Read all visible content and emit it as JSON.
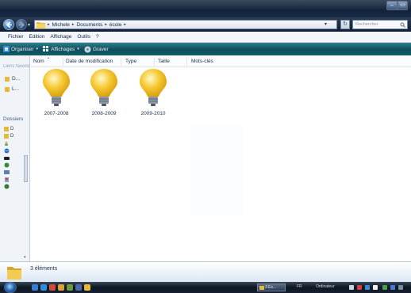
{
  "window": {
    "search_placeholder": "Rechercher",
    "breadcrumb": [
      "Michele",
      "Documents",
      "école"
    ],
    "controls": {
      "minimize": "–",
      "maximize": "▭"
    }
  },
  "menu": [
    "Fichier",
    "Edition",
    "Affichage",
    "Outils",
    "?"
  ],
  "toolbar": {
    "organize": "Organiser",
    "views": "Affichages",
    "burn": "Graver"
  },
  "left_pane": {
    "favorites_title": "Liens favoris",
    "favorites": [
      "D...",
      "L..."
    ],
    "folders_title": "Dossiers",
    "tree": [
      "D",
      "D",
      "",
      "",
      "",
      "",
      "",
      "",
      ""
    ]
  },
  "columns": [
    "Nom",
    "Date de modification",
    "Type",
    "Taille",
    "Mots-clés"
  ],
  "items": [
    {
      "name": "2007-2008",
      "icon": "lightbulb-icon"
    },
    {
      "name": "2008-2009",
      "icon": "lightbulb-icon"
    },
    {
      "name": "2009-2010",
      "icon": "lightbulb-icon"
    }
  ],
  "details": {
    "count_text": "3 éléments"
  },
  "taskbar": {
    "task_label": "3 Ex...",
    "language": "FR",
    "computer_label": "Ordinateur"
  },
  "colors": {
    "title_bar": "#12223a",
    "toolbar": "#0f4e5c",
    "bulb": "#f5c72e",
    "folder": "#e6b93a"
  }
}
